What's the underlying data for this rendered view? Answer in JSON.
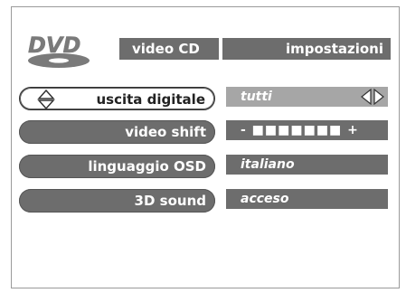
{
  "header": {
    "logo_text": "DVD",
    "tab_left": "video CD",
    "tab_right": "impostazioni"
  },
  "menu": [
    {
      "label": "uscita digitale",
      "value": "tutti"
    },
    {
      "label": "video shift",
      "value": "- ■■■■■■■ +"
    },
    {
      "label": "linguaggio OSD",
      "value": "italiano"
    },
    {
      "label": "3D sound",
      "value": "acceso"
    }
  ],
  "video_shift": {
    "minus": "-",
    "plus": "+",
    "segments_filled": 7
  },
  "colors": {
    "panel": "#6d6d6d",
    "selected_value": "#a6a6a6"
  },
  "icons": {
    "updown": "up-down-arrows-icon",
    "leftright": "left-right-arrows-icon"
  }
}
